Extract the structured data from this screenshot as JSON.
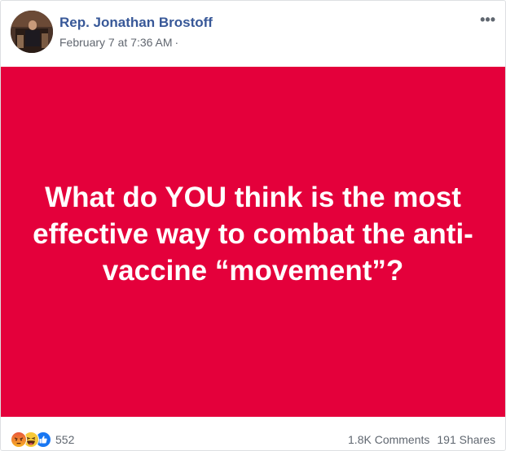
{
  "post": {
    "author": "Rep. Jonathan Brostoff",
    "timestamp": "February 7 at 7:36 AM",
    "separator": "·",
    "more_icon": "•••",
    "card": {
      "text": "What do YOU think is the most effective way to combat the anti-vaccine “movement”?",
      "background_color": "#e4003b",
      "text_color": "#ffffff"
    },
    "reactions": {
      "icons": [
        "angry-icon",
        "haha-icon",
        "like-icon"
      ],
      "count": "552"
    },
    "comments": "1.8K Comments",
    "shares": "191 Shares"
  },
  "colors": {
    "link": "#385898",
    "meta": "#616770",
    "accent": "#e4003b"
  }
}
